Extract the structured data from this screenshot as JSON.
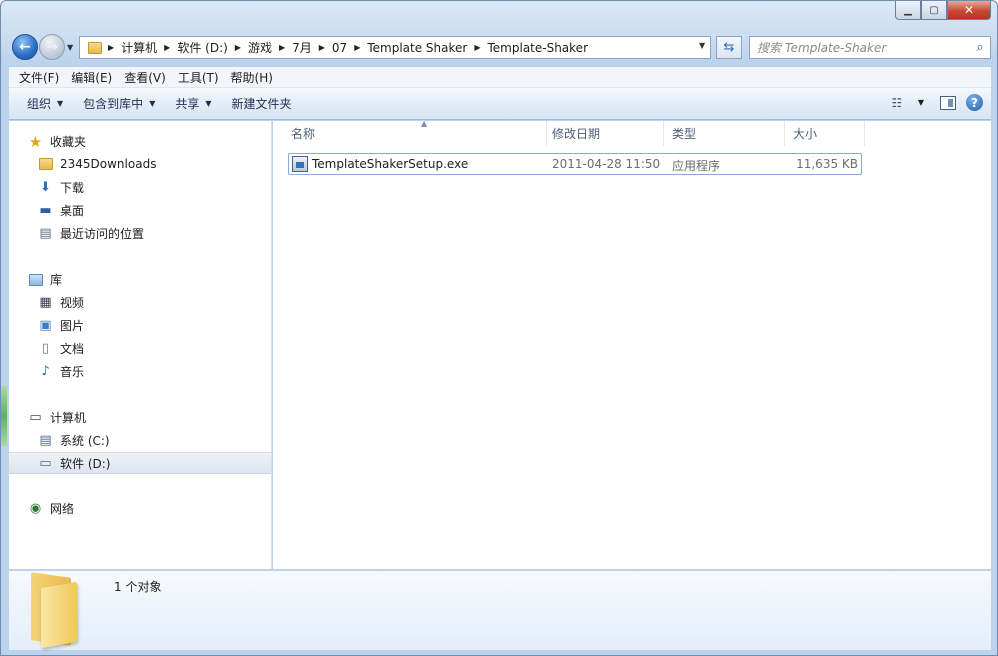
{
  "window": {
    "caption": {
      "minimize": "▁",
      "maximize": "▢",
      "close": "✕"
    }
  },
  "address": {
    "breadcrumbs": [
      "计算机",
      "软件 (D:)",
      "游戏",
      "7月",
      "07",
      "Template Shaker",
      "Template-Shaker"
    ]
  },
  "search": {
    "placeholder": "搜索 Template-Shaker"
  },
  "menu": [
    "文件(F)",
    "编辑(E)",
    "查看(V)",
    "工具(T)",
    "帮助(H)"
  ],
  "toolbar": {
    "organize": "组织",
    "include_library": "包含到库中",
    "share": "共享",
    "new_folder": "新建文件夹"
  },
  "navpane": {
    "favorites": {
      "label": "收藏夹",
      "items": [
        "2345Downloads",
        "下载",
        "桌面",
        "最近访问的位置"
      ]
    },
    "libraries": {
      "label": "库",
      "items": [
        "视频",
        "图片",
        "文档",
        "音乐"
      ]
    },
    "computer": {
      "label": "计算机",
      "items": [
        "系统 (C:)",
        "软件 (D:)"
      ],
      "selected": "软件 (D:)"
    },
    "network": {
      "label": "网络"
    }
  },
  "columns": {
    "name": "名称",
    "modified": "修改日期",
    "type": "类型",
    "size": "大小"
  },
  "files": [
    {
      "name": "TemplateShakerSetup.exe",
      "modified": "2011-04-28 11:50",
      "type": "应用程序",
      "size": "11,635 KB"
    }
  ],
  "details": {
    "count": "1 个对象"
  },
  "colors": {
    "accent": "#2a6fc7",
    "selection_border": "#84acdd",
    "chrome": "#c9dcf1"
  }
}
